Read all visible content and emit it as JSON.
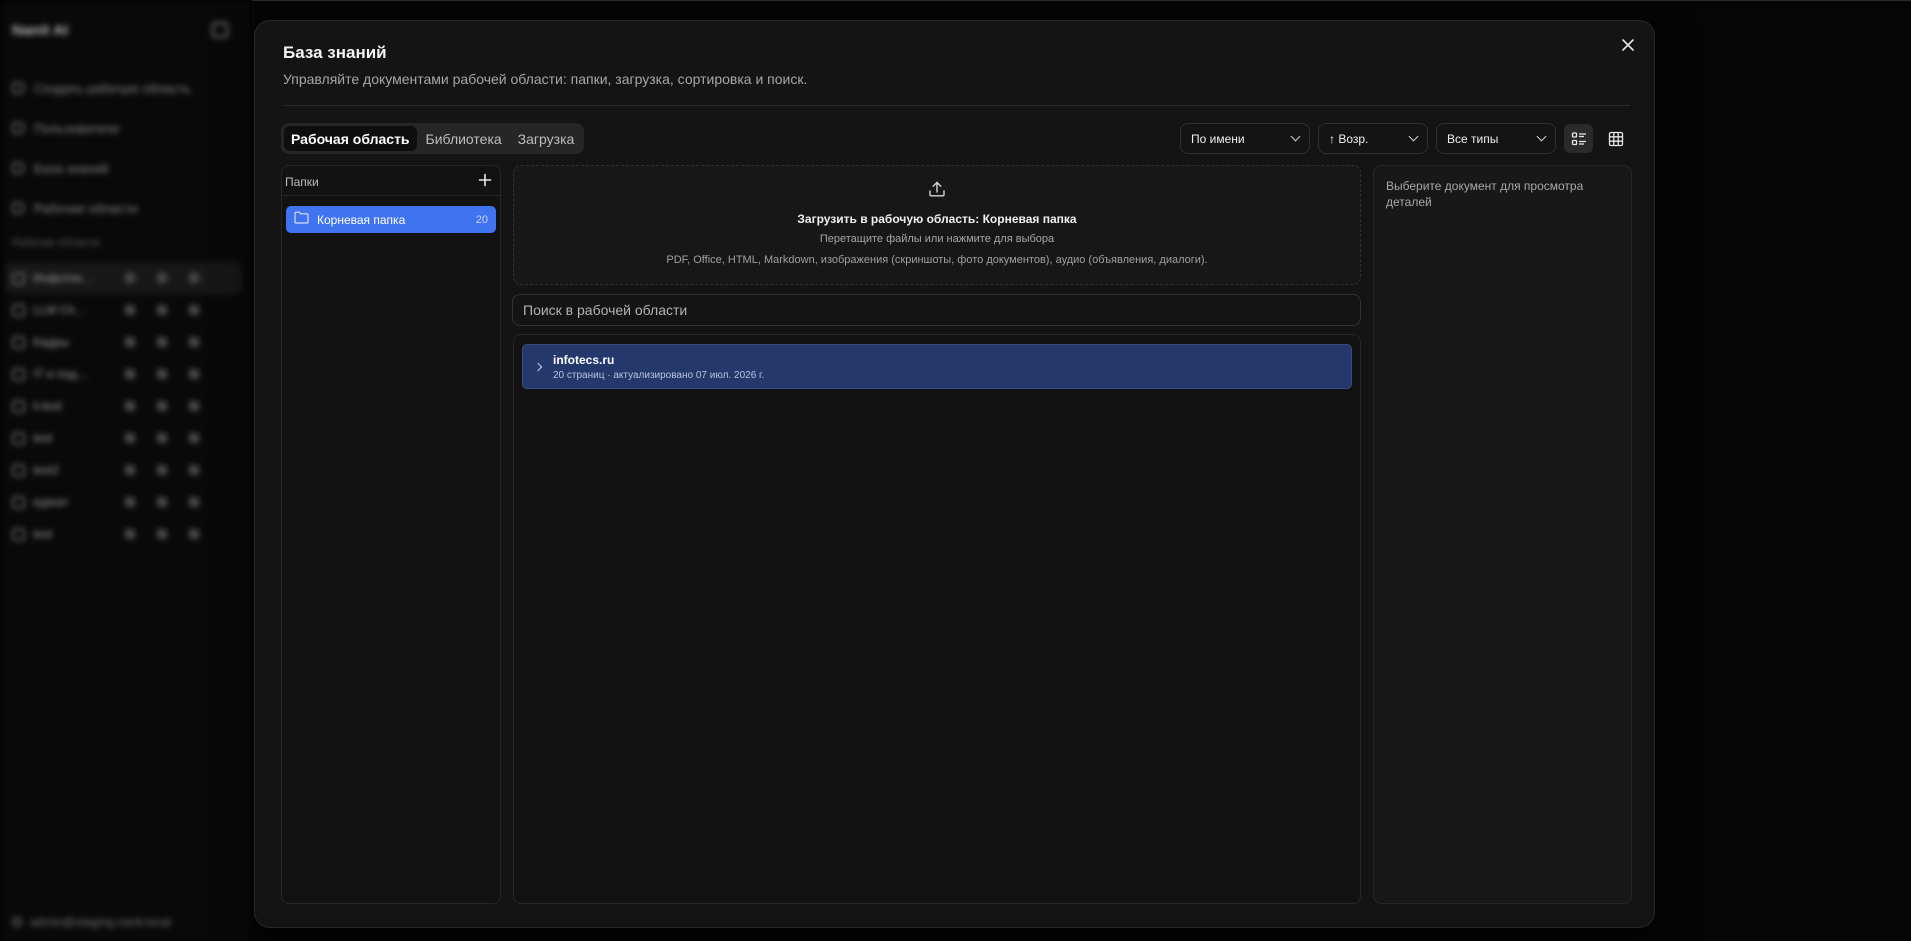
{
  "background": {
    "brand": "Nanit AI",
    "nav": [
      "Создать рабочую область",
      "Пользователи",
      "База знаний",
      "Рабочие области"
    ],
    "workspaces_title": "Рабочие области",
    "workspaces": [
      "Инфотек…",
      "LLM Ch…",
      "Кадры",
      "IT и под…",
      "ii-test",
      "test",
      "test2",
      "куркат",
      "test"
    ],
    "user_email": "admin@staging.nanit.local"
  },
  "modal": {
    "title": "База знаний",
    "subtitle": "Управляйте документами рабочей области: папки, загрузка, сортировка и поиск.",
    "close_icon": "close-icon",
    "tabs": [
      {
        "label": "Рабочая область",
        "active": true
      },
      {
        "label": "Библиотека",
        "active": false
      },
      {
        "label": "Загрузка",
        "active": false
      }
    ],
    "controls": {
      "sort_by": "По имени",
      "order": "↑ Возр.",
      "type_filter": "Все типы",
      "view_modes": [
        "list-view-icon",
        "grid-view-icon"
      ],
      "active_view": "list"
    },
    "folders": {
      "label": "Папки",
      "add_icon": "plus-icon",
      "items": [
        {
          "name": "Корневая папка",
          "count": "20",
          "icon": "folder-icon",
          "selected": true
        }
      ]
    },
    "upload": {
      "icon": "upload-icon",
      "title": "Загрузить в рабочую область: Корневая папка",
      "hint": "Перетащите файлы или нажмите для выбора",
      "formats": "PDF, Office, HTML, Markdown, изображения (скриншоты, фото документов), аудио (объявления, диалоги)."
    },
    "search": {
      "placeholder": "Поиск в рабочей области",
      "value": ""
    },
    "documents": [
      {
        "name": "infotecs.ru",
        "meta": "20 страниц · актуализировано 07 июл. 2026 г.",
        "selected": true
      }
    ],
    "details": {
      "empty_text": "Выберите документ для просмотра деталей"
    }
  },
  "colors": {
    "accent": "#3f73f0",
    "selected_row": "#24386b",
    "modal_bg": "#141414"
  }
}
